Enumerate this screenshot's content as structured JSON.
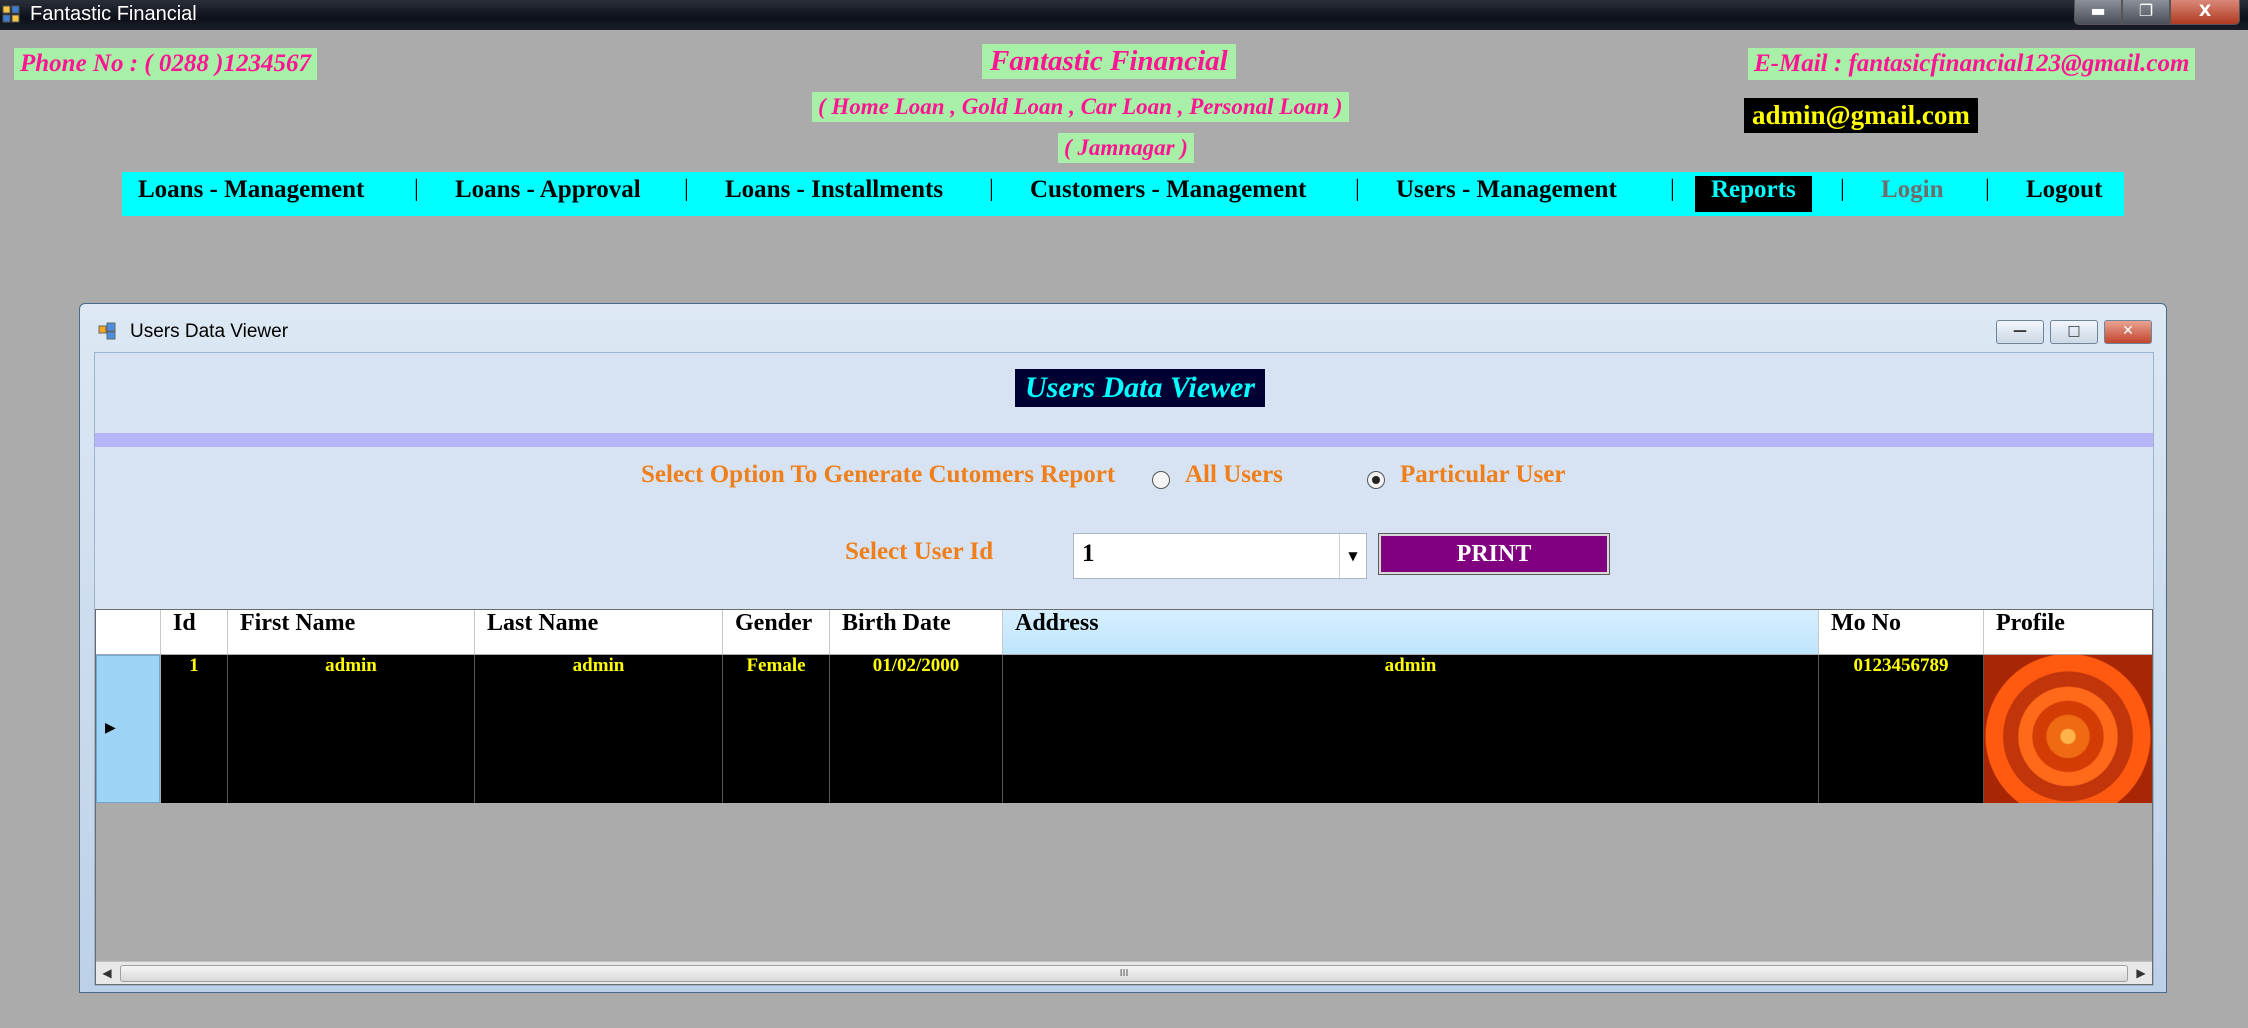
{
  "app": {
    "title": "Fantastic Financial",
    "controls": {
      "minimize": "▬",
      "maximize": "❐",
      "close": "X"
    }
  },
  "header": {
    "phone": "Phone No : ( 0288 )1234567",
    "company": "Fantastic Financial",
    "services": "( Home Loan , Gold Loan , Car Loan , Personal Loan )",
    "city": "( Jamnagar )",
    "email": "E-Mail : fantasicfinancial123@gmail.com",
    "logged_user": "admin@gmail.com"
  },
  "menu": {
    "items": [
      {
        "label": "Loans - Management"
      },
      {
        "label": "Loans - Approval"
      },
      {
        "label": "Loans - Installments"
      },
      {
        "label": "Customers - Management"
      },
      {
        "label": "Users - Management"
      },
      {
        "label": "Reports"
      },
      {
        "label": "Login"
      },
      {
        "label": "Logout"
      }
    ],
    "separator": "|",
    "active": "Reports",
    "disabled": "Login"
  },
  "child_window": {
    "title": "Users Data Viewer",
    "controls": {
      "minimize": "—",
      "maximize": "□",
      "close": "✕"
    }
  },
  "viewer": {
    "heading": "Users Data Viewer",
    "option_label": "Select Option To Generate Cutomers Report",
    "radio_all": "All Users",
    "radio_particular": "Particular User",
    "selected_option": "Particular User",
    "user_id_label": "Select User Id",
    "user_id_value": "1",
    "print_label": "PRINT"
  },
  "grid": {
    "columns": [
      "Id",
      "First Name",
      "Last Name",
      "Gender",
      "Birth Date",
      "Address",
      "Mo No",
      "Profile"
    ],
    "selected_column": "Address",
    "rows": [
      {
        "id": "1",
        "first_name": "admin",
        "last_name": "admin",
        "gender": "Female",
        "birth_date": "01/02/2000",
        "address": "admin",
        "mo_no": "0123456789",
        "profile": "flower-image"
      }
    ],
    "scroll_thumb": "III"
  },
  "colors": {
    "menu_bg": "#00ffff",
    "header_text": "#ff1493",
    "header_bg": "#a8f0a8",
    "accent_orange": "#ef7f1a",
    "print_bg": "#800080",
    "cell_text": "#ffff00"
  }
}
